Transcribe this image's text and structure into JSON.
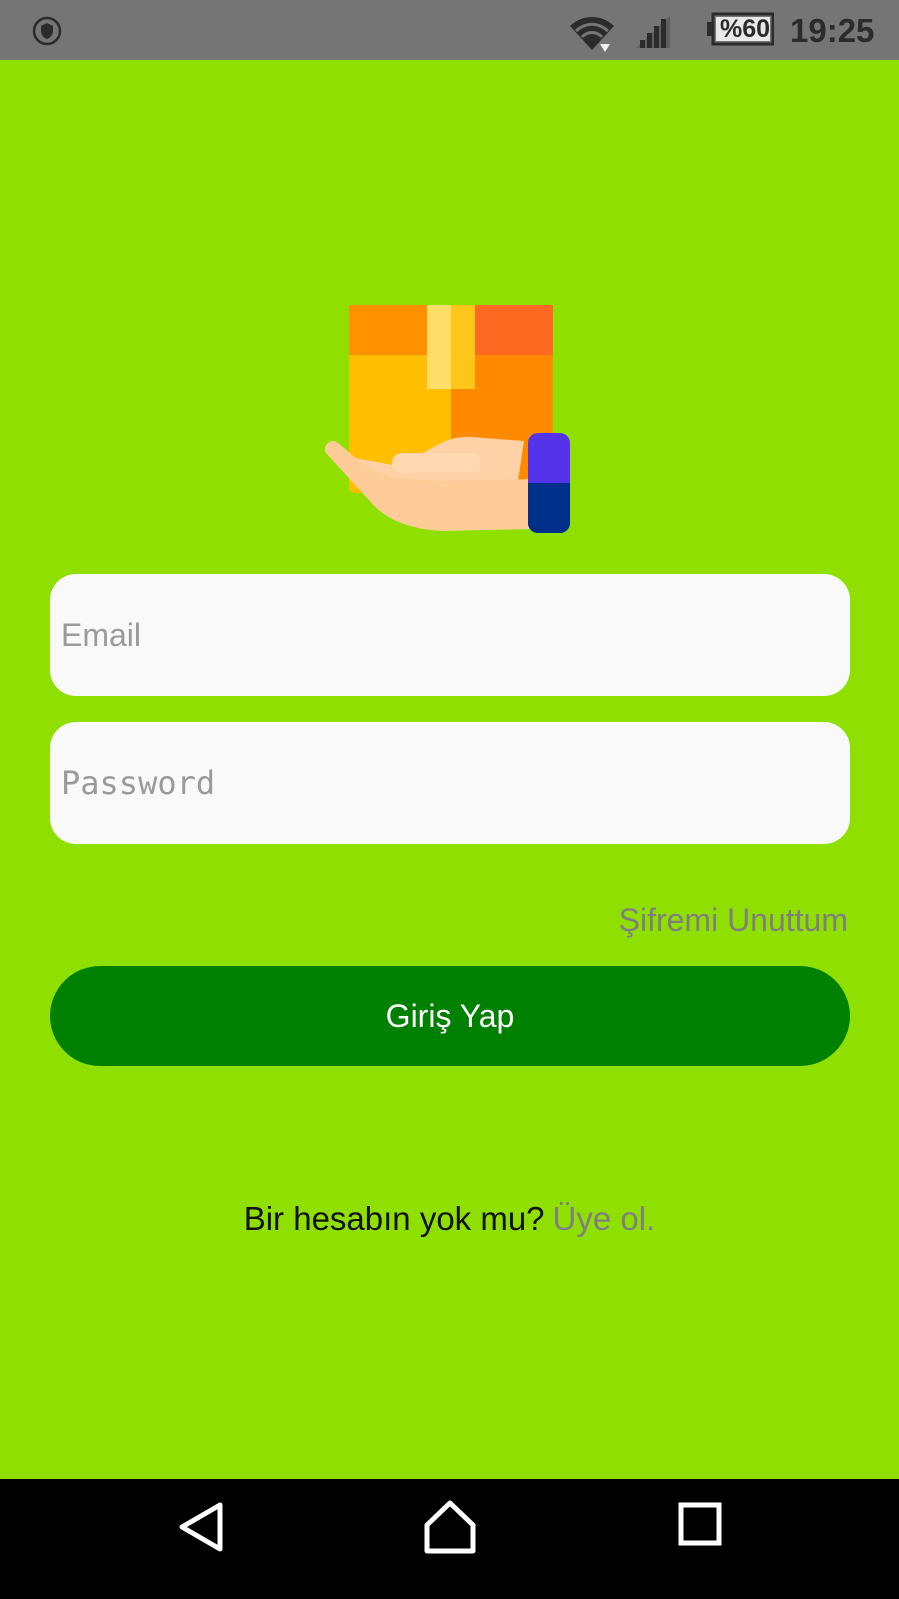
{
  "status_bar": {
    "battery": "%60",
    "time": "19:25",
    "icons": [
      "shield-icon",
      "wifi-icon",
      "signal-icon",
      "battery-icon"
    ]
  },
  "logo": {
    "icon": "hand-holding-package-icon"
  },
  "form": {
    "email_placeholder": "Email",
    "email_value": "",
    "password_placeholder": "Password",
    "password_value": "",
    "forgot_label": "Şifremi Unuttum",
    "login_label": "Giriş Yap"
  },
  "signup": {
    "prompt": "Bir hesabın yok mu?",
    "link": "Üye ol."
  },
  "nav_bar": {
    "icons": [
      "back-icon",
      "home-icon",
      "recent-apps-icon"
    ]
  },
  "colors": {
    "background": "#8fe000",
    "button": "#008000",
    "field": "#f9f9f9",
    "link": "#7f7f7f"
  }
}
